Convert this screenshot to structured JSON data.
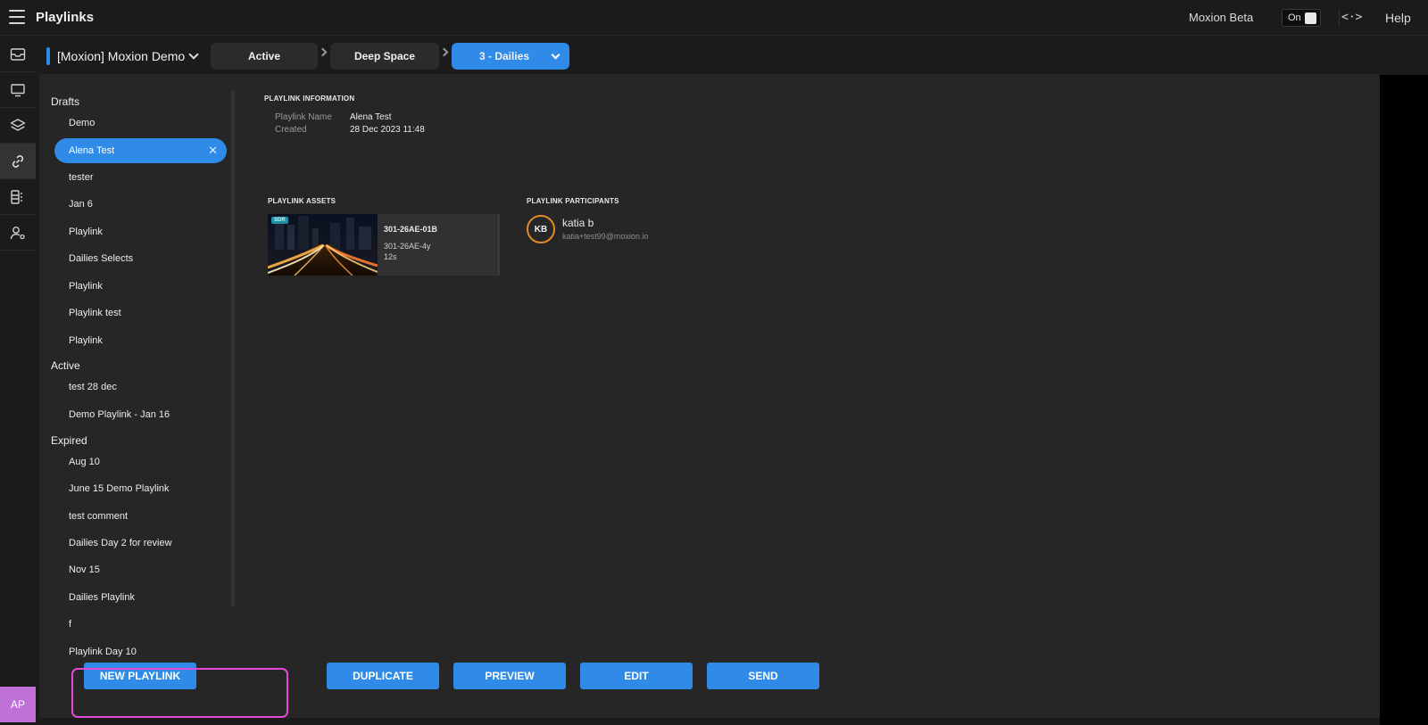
{
  "header": {
    "title": "Playlinks",
    "beta_label": "Moxion Beta",
    "toggle_label": "On",
    "code_icon": "<·>",
    "help": "Help"
  },
  "rail": {
    "items": [
      "inbox-icon",
      "monitor-icon",
      "layers-icon",
      "link-icon",
      "dailies-icon",
      "user-settings-icon"
    ],
    "avatar": "AP"
  },
  "breadcrumb": {
    "project": "[Moxion] Moxion Demo",
    "crumbs": [
      "Active",
      "Deep Space",
      "3 - Dailies"
    ]
  },
  "sidebar": {
    "drafts_title": "Drafts",
    "drafts": [
      "Demo",
      "Alena Test",
      "tester",
      "Jan 6",
      "Playlink",
      "Dailies Selects",
      "Playlink",
      "Playlink test",
      "Playlink"
    ],
    "active_title": "Active",
    "active": [
      "test 28 dec",
      "Demo Playlink - Jan 16"
    ],
    "expired_title": "Expired",
    "expired": [
      "Aug 10",
      "June 15 Demo Playlink",
      "test comment",
      "Dailies Day 2 for review",
      "Nov 15",
      "Dailies Playlink",
      "f",
      "Playlink Day 10"
    ],
    "close_glyph": "✕"
  },
  "info": {
    "title": "PLAYLINK INFORMATION",
    "name_label": "Playlink Name",
    "name_value": "Alena Test",
    "created_label": "Created",
    "created_value": "28 Dec 2023 11:48"
  },
  "assets": {
    "title": "PLAYLINK ASSETS",
    "items": [
      {
        "badge": "SDR",
        "name": "301-26AE-01B",
        "version": "301-26AE-4y",
        "duration": "12s"
      }
    ]
  },
  "participants": {
    "title": "PLAYLINK PARTICIPANTS",
    "items": [
      {
        "initials": "KB",
        "name": "katia b",
        "email": "katia+test99@moxion.io"
      }
    ]
  },
  "actions": {
    "new": "NEW PLAYLINK",
    "duplicate": "DUPLICATE",
    "preview": "PREVIEW",
    "edit": "EDIT",
    "send": "SEND"
  },
  "colors": {
    "accent": "#2f8be7",
    "highlight": "#e548d9",
    "avatar_ring": "#e08a2a",
    "rail_avatar": "#c071d8"
  }
}
